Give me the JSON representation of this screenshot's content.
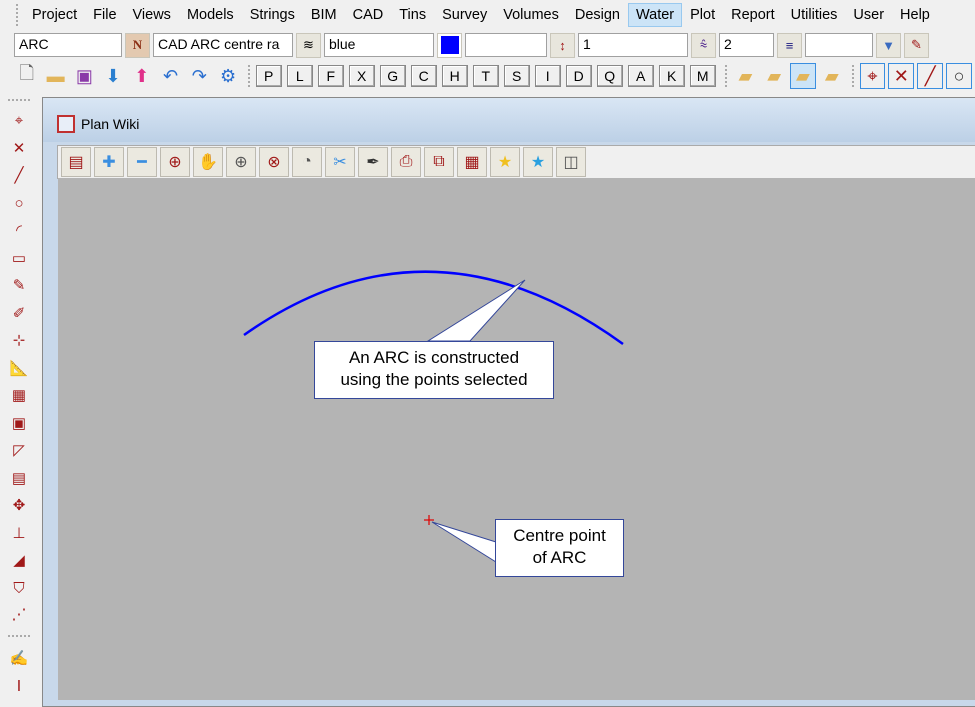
{
  "menu": [
    "Project",
    "File",
    "Views",
    "Models",
    "Strings",
    "BIM",
    "CAD",
    "Tins",
    "Survey",
    "Volumes",
    "Design",
    "Water",
    "Plot",
    "Report",
    "Utilities",
    "User",
    "Help"
  ],
  "toolbar1": {
    "name": "ARC",
    "n_label": "N",
    "description": "CAD ARC centre ra",
    "colour": "blue",
    "colour_hex": "#0000ff",
    "field4": "",
    "weight": "1",
    "linestyle_count": "2",
    "field7": ""
  },
  "toolbar2": {
    "letters": [
      "P",
      "L",
      "F",
      "X",
      "G",
      "C",
      "H",
      "T",
      "S",
      "I",
      "D",
      "Q",
      "A",
      "K",
      "M"
    ]
  },
  "window": {
    "title": "Plan Wiki"
  },
  "canvas": {
    "arc_color": "#0000ff",
    "centre_color": "#e00000",
    "callout1": [
      "An ARC is constructed",
      "using the points selected"
    ],
    "callout2": [
      "Centre point",
      "of ARC"
    ]
  }
}
